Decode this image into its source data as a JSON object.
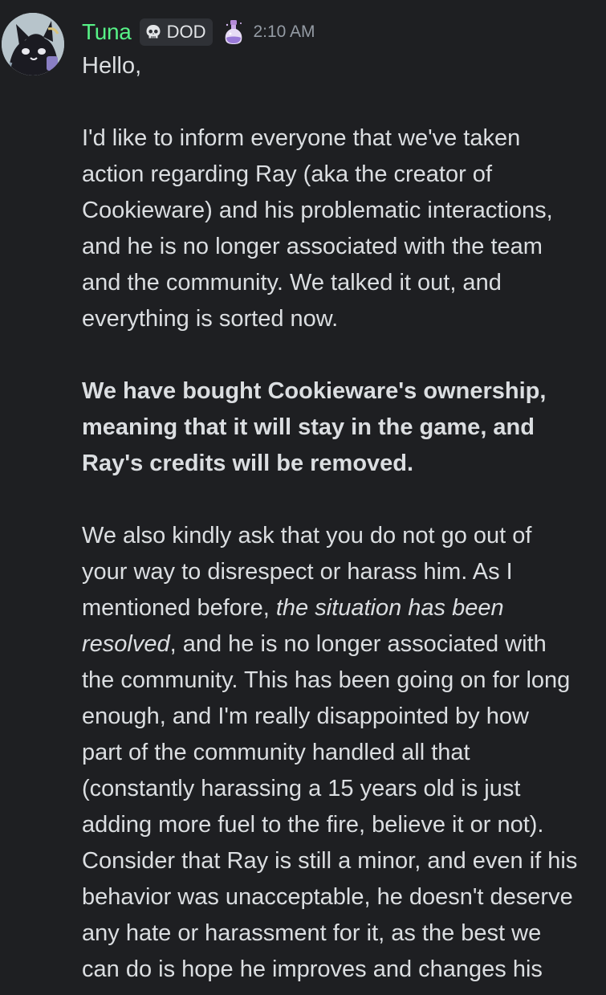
{
  "message": {
    "author": "Tuna",
    "tag_label": "DOD",
    "timestamp": "2:10 AM",
    "greeting": "Hello,",
    "para1": [
      "I'd like to inform everyone that we've taken",
      "action regarding Ray (aka the creator of",
      "Cookieware) and his problematic interactions,",
      "and he is no longer associated with the team",
      "and the community. We talked it out, and",
      "everything is sorted now."
    ],
    "para2_bold": [
      "We have bought Cookieware's ownership,",
      "meaning that it will stay in the game, and",
      "Ray's credits will be removed."
    ],
    "para3": {
      "l1": "We also kindly ask that you do not go out of",
      "l2": "your way to disrespect or harass him. As I",
      "l3_prefix": "mentioned before, ",
      "l3_italic": "the situation has been",
      "l4_italic": "resolved",
      "l4_suffix": ", and he is no longer associated with",
      "rest": [
        "the community. This has been going on for long",
        "enough, and I'm really disappointed by how",
        "part of the community handled all that",
        "(constantly harassing a 15 years old is just",
        "adding more fuel to the fire, believe it or not).",
        "Consider that Ray is still a minor, and even if his",
        "behavior was unacceptable, he doesn't deserve",
        "any hate or harassment for it, as the best we",
        "can do is hope he improves and changes his"
      ]
    }
  },
  "colors": {
    "background": "#1e1f22",
    "username": "#57f287",
    "text": "#dbdee1",
    "timestamp": "#949ba4",
    "tag_bg": "#2f3136"
  },
  "icons": {
    "avatar": "cat-avatar",
    "tag": "skull-icon",
    "role": "potion-icon"
  }
}
